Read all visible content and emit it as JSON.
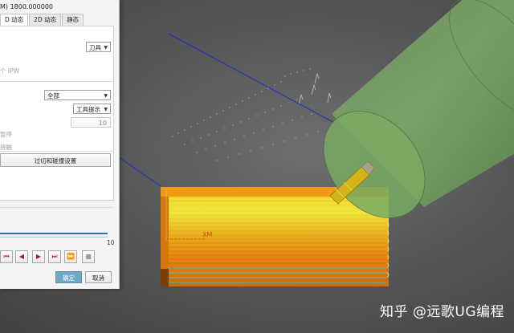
{
  "dialog": {
    "title_fragment": "M) 1800.000000",
    "tabs": [
      {
        "label": "D 动态"
      },
      {
        "label": "2D 动态"
      },
      {
        "label": "静态"
      }
    ],
    "display_select": {
      "value": "刀具"
    },
    "ipw_label": "个 IPW",
    "all_select": {
      "value": "全部"
    },
    "tool_tip_select": {
      "value": "工具提示"
    },
    "count_value": "10",
    "pause_label": "暂停",
    "collision_label": "接触",
    "overcut_button": "过切和碰撞设置",
    "slider_max": "10",
    "controls": {
      "to_start": "⏮",
      "step_back": "◀",
      "play": "▶",
      "to_end": "⏭",
      "fast_forward": "⏩",
      "stop": "■"
    },
    "ok_button": "确定",
    "cancel_button": "取消"
  },
  "viewport": {
    "axis_label": "XM",
    "watermark": "知乎 @远歌UG编程",
    "colors": {
      "background": "#555758",
      "tool_holder": "#7fb06a",
      "tool": "#d6b21a",
      "stock_orange": "#e8920e",
      "stock_yellow": "#e6e02a",
      "stock_cyan": "#43c8b8",
      "path_blue": "#1f2fc0"
    }
  }
}
